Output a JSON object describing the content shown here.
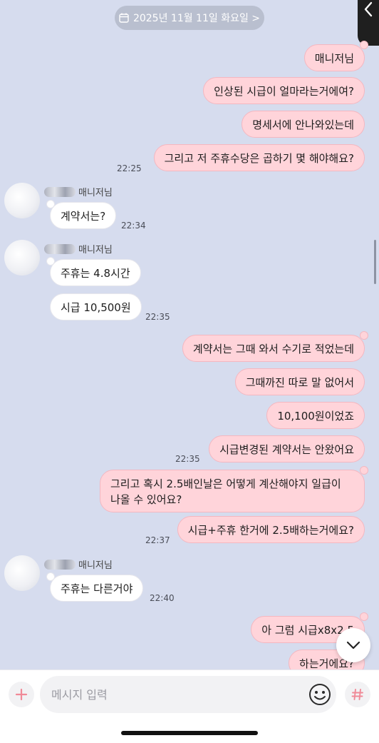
{
  "header": {
    "date_label": "2025년 11월 11일 화요일 >"
  },
  "sender": {
    "name": "매니저님"
  },
  "messages": {
    "s1": "매니저님",
    "s2": "인상된 시급이 얼마라는거에여?",
    "s3": "명세서에 안나와있는데",
    "s4": "그리고 저 주휴수당은 곱하기 몇 해야해요?",
    "t1": "22:25",
    "r1": "계약서는?",
    "t2": "22:34",
    "r2": "주휴는 4.8시간",
    "r3": "시급 10,500원",
    "t3": "22:35",
    "s5": "계약서는 그때 와서 수기로 적었는데",
    "s6": "그때까진 따로 말 없어서",
    "s7": "10,100원이었죠",
    "s8": "시급변경된 계약서는 안왔어요",
    "t4": "22:35",
    "s9": "그리고 혹시 2.5배인날은 어떻게 계산해야지 일급이 나올 수 있어요?",
    "s10": "시급+주휴 한거에 2.5배하는거에요?",
    "t5": "22:37",
    "r4": "주휴는 다른거야",
    "t6": "22:40",
    "s11": "아 그럼 시급x8x2.5",
    "s12": "하는거에요?"
  },
  "input": {
    "placeholder": "메시지 입력"
  },
  "icons": {
    "calendar": "calendar-icon",
    "back": "chevron-left-icon",
    "plus": "plus-icon",
    "emoji": "emoji-icon",
    "hash": "hashtag-icon",
    "scroll_down": "chevron-down-icon"
  },
  "colors": {
    "background": "#d6dcee",
    "sent_bubble": "#ffd4da",
    "received_bubble": "#ffffff",
    "accent": "#f08a98"
  }
}
